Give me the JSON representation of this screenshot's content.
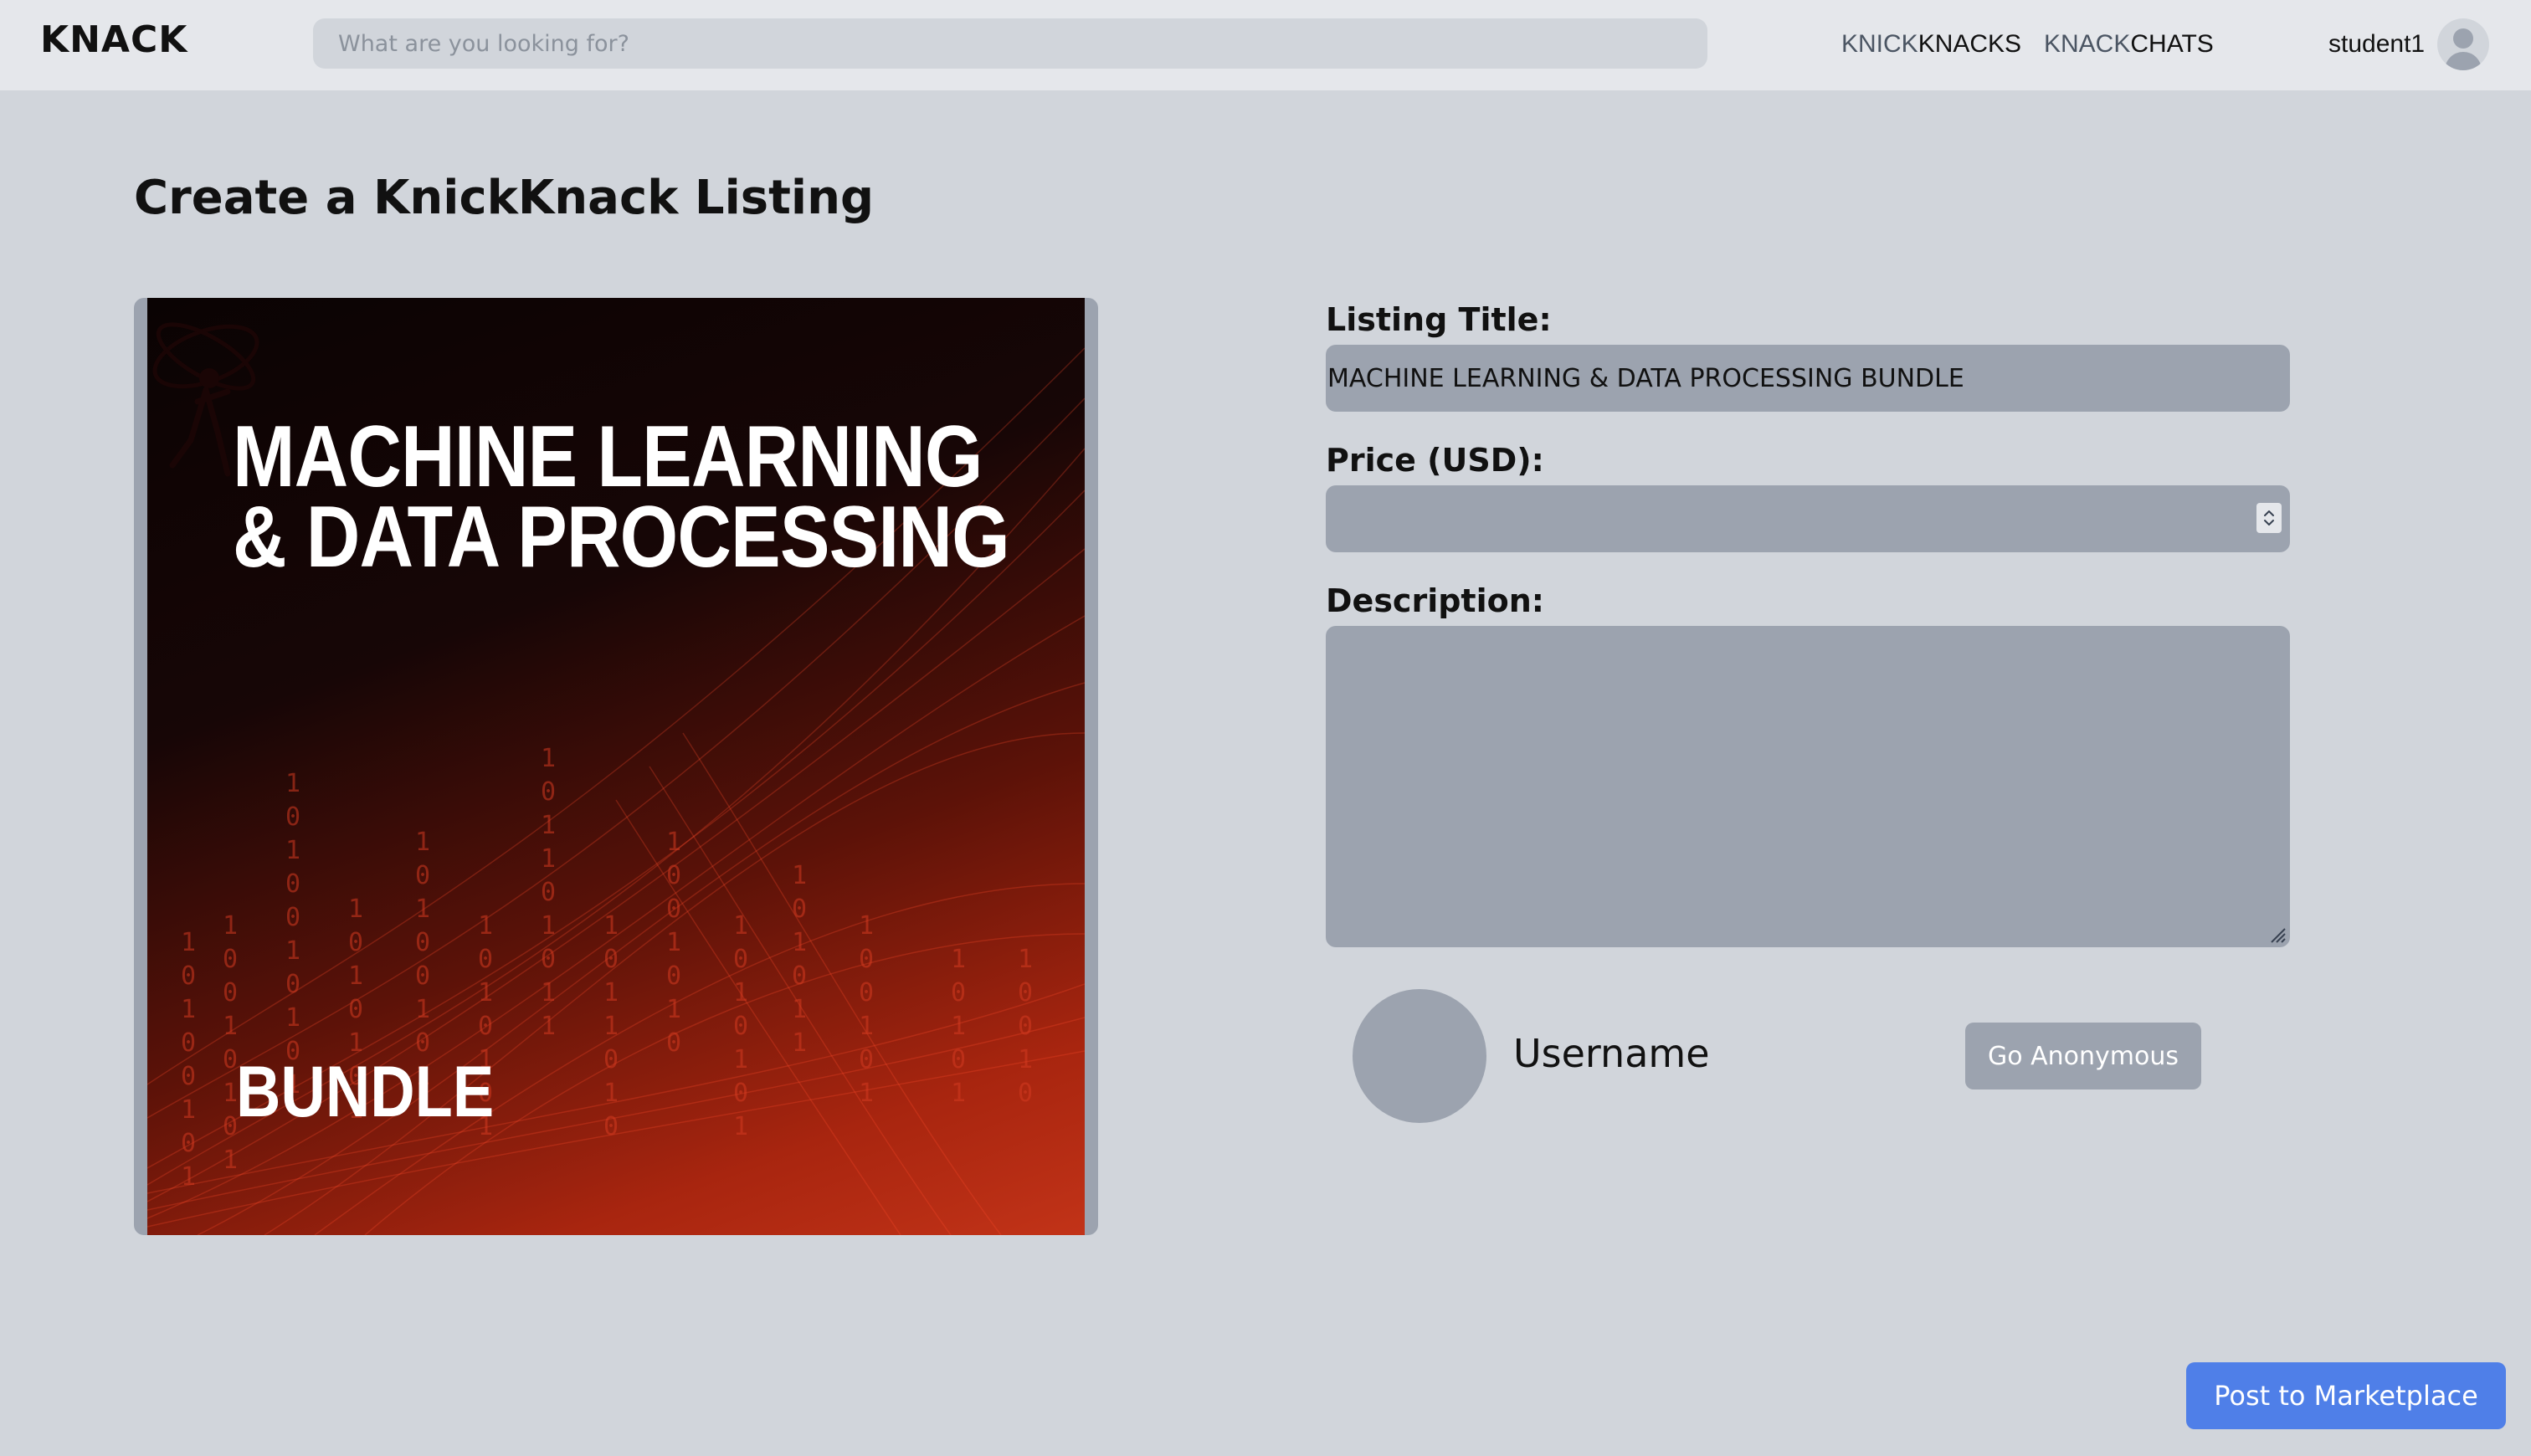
{
  "header": {
    "brand": "KNACK",
    "search_placeholder": "What are you looking for?",
    "nav": [
      {
        "prefix": "KNICK",
        "main": "KNACKS"
      },
      {
        "prefix": "KNACK",
        "main": "CHATS"
      }
    ],
    "username": "student1",
    "avatar_icon": "user-avatar-icon"
  },
  "page": {
    "title": "Create a KnickKnack Listing"
  },
  "listing_image": {
    "title_line1": "MACHINE LEARNING",
    "title_line2": "& DATA PROCESSING",
    "subtitle": "BUNDLE"
  },
  "form": {
    "title_label": "Listing Title:",
    "title_value": "MACHINE LEARNING & DATA PROCESSING BUNDLE",
    "price_label": "Price (USD):",
    "price_value": "",
    "description_label": "Description:",
    "description_value": ""
  },
  "seller": {
    "username": "Username",
    "anon_button": "Go Anonymous"
  },
  "actions": {
    "post_button": "Post to Marketplace"
  },
  "colors": {
    "background": "#d1d5db",
    "header": "#e5e7eb",
    "field": "#9ca3af",
    "primary": "#4f7fe8"
  }
}
